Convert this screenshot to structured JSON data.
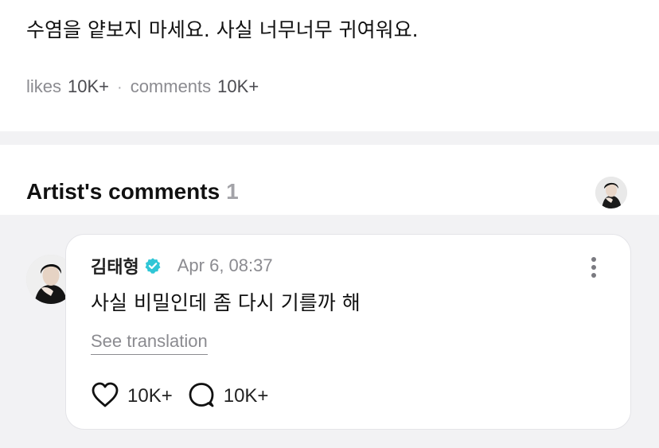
{
  "post": {
    "text": "수염을 얕보지 마세요. 사실 너무너무 귀여워요.",
    "likes_label": "likes",
    "likes_value": "10K+",
    "separator": "·",
    "comments_label": "comments",
    "comments_value": "10K+"
  },
  "artist_comments": {
    "title": "Artist's comments",
    "count": "1"
  },
  "comment": {
    "author": "김태형",
    "time": "Apr 6, 08:37",
    "body": "사실 비밀인데 좀 다시 기를까 해",
    "see_translation": "See translation",
    "like_count": "10K+",
    "reply_count": "10K+"
  },
  "colors": {
    "verified_badge": "#2fc6d6",
    "muted_text": "#8b8b90",
    "page_background": "#f2f2f4"
  },
  "icons": {
    "verified": "verified-badge-icon",
    "more": "more-vertical-icon",
    "like": "heart-outline-icon",
    "reply": "speech-bubble-outline-icon"
  }
}
